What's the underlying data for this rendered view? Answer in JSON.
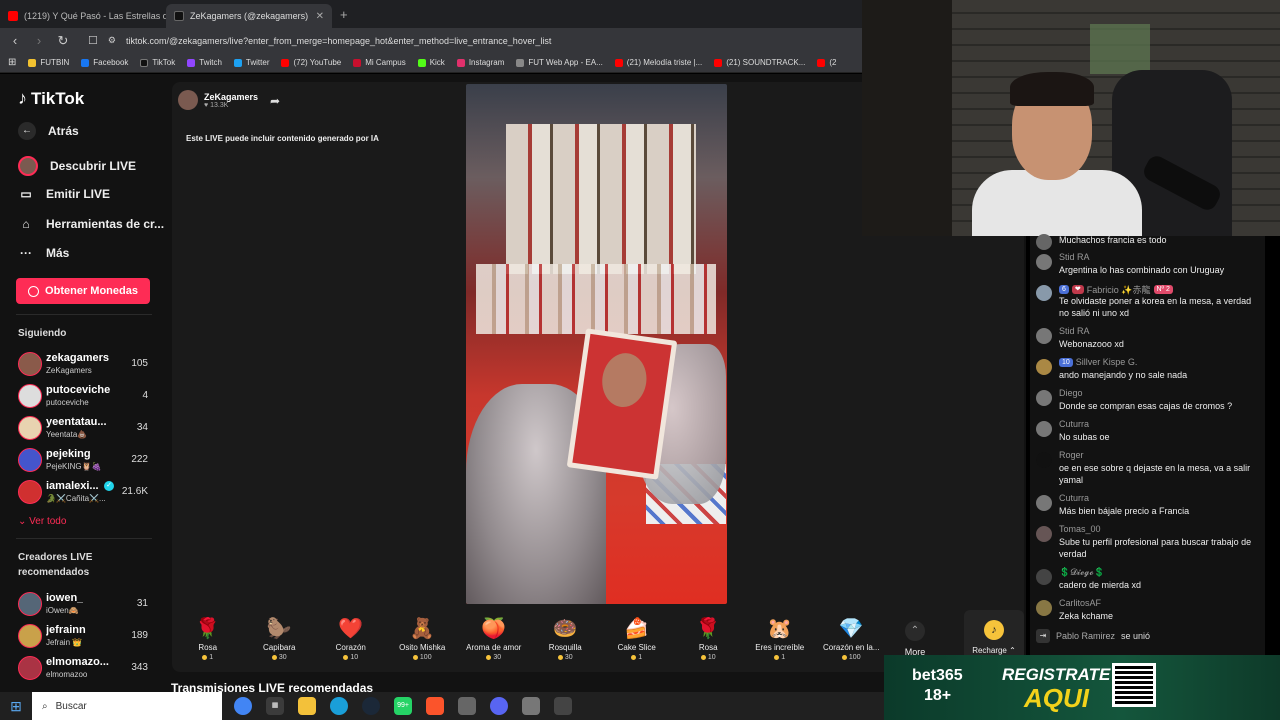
{
  "browser": {
    "tabs": [
      {
        "title": "(1219) Y Qué Pasó - Las Estrellas de la",
        "fav_color": "#ff0000"
      },
      {
        "title": "ZeKagamers (@zekagamers) ",
        "fav_color": "#222222",
        "active": true
      }
    ],
    "new_tab": "+",
    "url": "tiktok.com/@zekagamers/live?enter_from_merge=homepage_hot&enter_method=live_entrance_hover_list",
    "bookmarks": [
      {
        "label": "FUTBIN",
        "color": "#f2c230"
      },
      {
        "label": "Facebook",
        "color": "#1877f2"
      },
      {
        "label": "TikTok",
        "color": "#111111"
      },
      {
        "label": "Twitch",
        "color": "#9146ff"
      },
      {
        "label": "Twitter",
        "color": "#1da1f2"
      },
      {
        "label": "(72) YouTube",
        "color": "#ff0000"
      },
      {
        "label": "Mi Campus",
        "color": "#c8102e"
      },
      {
        "label": "Kick",
        "color": "#53fc18"
      },
      {
        "label": "Instagram",
        "color": "#e1306c"
      },
      {
        "label": "FUT Web App - EA...",
        "color": "#888888"
      },
      {
        "label": "(21) Melodía triste |...",
        "color": "#ff0000"
      },
      {
        "label": "(21) SOUNDTRACK...",
        "color": "#ff0000"
      },
      {
        "label": "(2",
        "color": "#ff0000"
      }
    ]
  },
  "sidebar": {
    "logo": "TikTok",
    "back": "Atrás",
    "menu": [
      {
        "label": "Descubrir LIVE",
        "icon": "live-avatar-icon"
      },
      {
        "label": "Emitir LIVE",
        "icon": "camera-icon"
      },
      {
        "label": "Herramientas de cr...",
        "icon": "home-tools-icon"
      },
      {
        "label": "Más",
        "icon": "more-dots-icon"
      }
    ],
    "coins_button": "Obtener Monedas",
    "following_title": "Siguiendo",
    "following": [
      {
        "name": "zekagamers",
        "sub": "ZeKagamers",
        "count": "105",
        "color": "#8a5a4a"
      },
      {
        "name": "putoceviche",
        "sub": "putoceviche",
        "count": "4",
        "color": "#dddddd"
      },
      {
        "name": "yeentatau...",
        "sub": "Yeentata💩",
        "count": "34",
        "color": "#e8d3b0"
      },
      {
        "name": "pejeking",
        "sub": "PejeKING🦉🍇",
        "count": "222",
        "color": "#4455cc"
      },
      {
        "name": "iamalexi...",
        "sub": "🐊⚔️Cañita⚔️...",
        "count": "21.6K",
        "color": "#d03030",
        "verified": true
      }
    ],
    "see_all": "Ver todo",
    "recommended_title": "Creadores LIVE recomendados",
    "recommended": [
      {
        "name": "iowen_",
        "sub": "iOwen🙈",
        "count": "31",
        "color": "#556677"
      },
      {
        "name": "jefrainn",
        "sub": "Jefrain 👑",
        "count": "189",
        "color": "#c9a14a"
      },
      {
        "name": "elmomazo...",
        "sub": "elmomazoo",
        "count": "343",
        "color": "#aa3344"
      }
    ]
  },
  "stream": {
    "host_name": "ZeKagamers",
    "host_likes": "13.3K",
    "ai_notice": "Este LIVE puede incluir contenido generado por IA",
    "gifts": [
      {
        "name": "Rosa",
        "price": "1",
        "icon": "🌹"
      },
      {
        "name": "Capibara",
        "price": "30",
        "icon": "🦫"
      },
      {
        "name": "Corazón",
        "price": "10",
        "icon": "❤️"
      },
      {
        "name": "Osito Mishka",
        "price": "100",
        "icon": "🧸"
      },
      {
        "name": "Aroma de amor",
        "price": "30",
        "icon": "🍑"
      },
      {
        "name": "Rosquilla",
        "price": "30",
        "icon": "🍩"
      },
      {
        "name": "Cake Slice",
        "price": "1",
        "icon": "🍰"
      },
      {
        "name": "Rosa",
        "price": "10",
        "icon": "🌹"
      },
      {
        "name": "Eres increíble",
        "price": "1",
        "icon": "🐹"
      },
      {
        "name": "Corazón en la...",
        "price": "100",
        "icon": "💎"
      }
    ],
    "more_label": "More",
    "recharge_label": "Recharge ⌃",
    "recommended_section": "Transmisiones LIVE recomendadas"
  },
  "chat": {
    "messages": [
      {
        "user": "",
        "text": "Muchachos francia es todo",
        "color": "#666666"
      },
      {
        "user": "Stid RA",
        "text": "Argentina lo has combinado con Uruguay",
        "color": "#777777"
      },
      {
        "user": "Fabricio ✨赤龍",
        "text": "Te olvidaste poner a korea en la mesa, a verdad no salió ni uno xd",
        "color": "#8899aa",
        "badges": [
          "6",
          "❤",
          "Nº 2"
        ]
      },
      {
        "user": "Stid RA",
        "text": "Webonazooo xd",
        "color": "#777777"
      },
      {
        "user": "Sillver Kispe G.",
        "text": "ando manejando y no sale nada",
        "color": "#aa8844",
        "badges": [
          "10"
        ]
      },
      {
        "user": "Diego",
        "text": "Donde se compran esas cajas de cromos ?",
        "color": "#777777"
      },
      {
        "user": "Cuturra",
        "text": "No subas oe",
        "color": "#777777"
      },
      {
        "user": "Roger",
        "text": "oe en ese sobre q dejaste en la mesa, va a salir yamal",
        "color": "#111111"
      },
      {
        "user": "Cuturra",
        "text": "Más bien bájale precio a Francia",
        "color": "#777777"
      },
      {
        "user": "Tomas_00",
        "text": "Sube tu perfil profesional para buscar trabajo de verdad",
        "color": "#665555"
      },
      {
        "user": "💲𝓓𝓲𝓮𝓰𝓸💲",
        "text": "cadero de mierda xd",
        "color": "#444444"
      },
      {
        "user": "CarlitosAF",
        "text": "Zeka kchame",
        "color": "#887744"
      }
    ],
    "joined_user": "Pablo Ramirez",
    "joined_text": "se unió"
  },
  "ad": {
    "brand": "bet365",
    "age": "18+",
    "cta_top": "REGISTRATE",
    "cta_bottom": "AQUI"
  },
  "taskbar": {
    "search_label": "Buscar",
    "badge": "99+"
  }
}
